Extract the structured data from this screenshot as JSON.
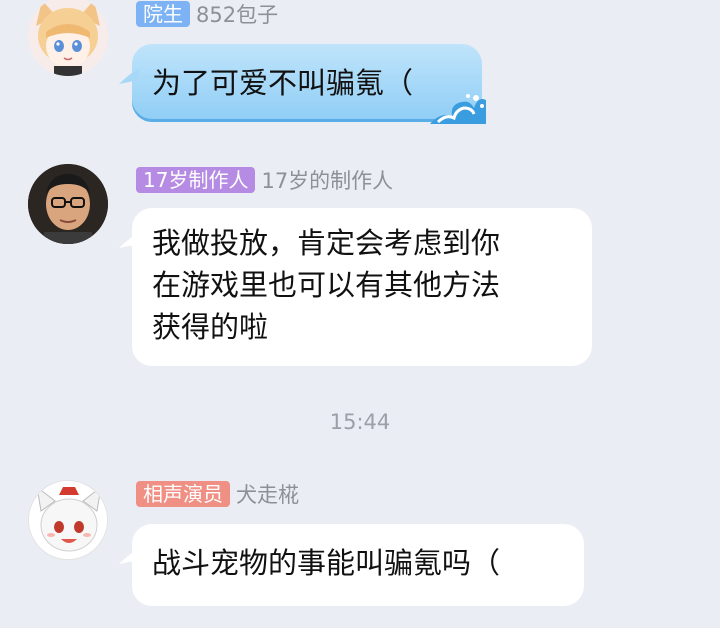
{
  "messages": [
    {
      "badge": "院生",
      "badge_color": "#7db2f5",
      "nickname": "852包子",
      "text": "为了可爱不叫骗氪（",
      "bubble_style": "blue-wave"
    },
    {
      "badge": "17岁制作人",
      "badge_color": "#b58be3",
      "nickname": "17岁的制作人",
      "lines": [
        "我做投放，肯定会考虑到你",
        "在游戏里也可以有其他方法",
        "获得的啦"
      ],
      "bubble_style": "white"
    },
    {
      "badge": "相声演员",
      "badge_color": "#f08f84",
      "nickname": "犬走椛",
      "text": "战斗宠物的事能叫骗氪吗（",
      "bubble_style": "white"
    }
  ],
  "timestamp": "15:44"
}
